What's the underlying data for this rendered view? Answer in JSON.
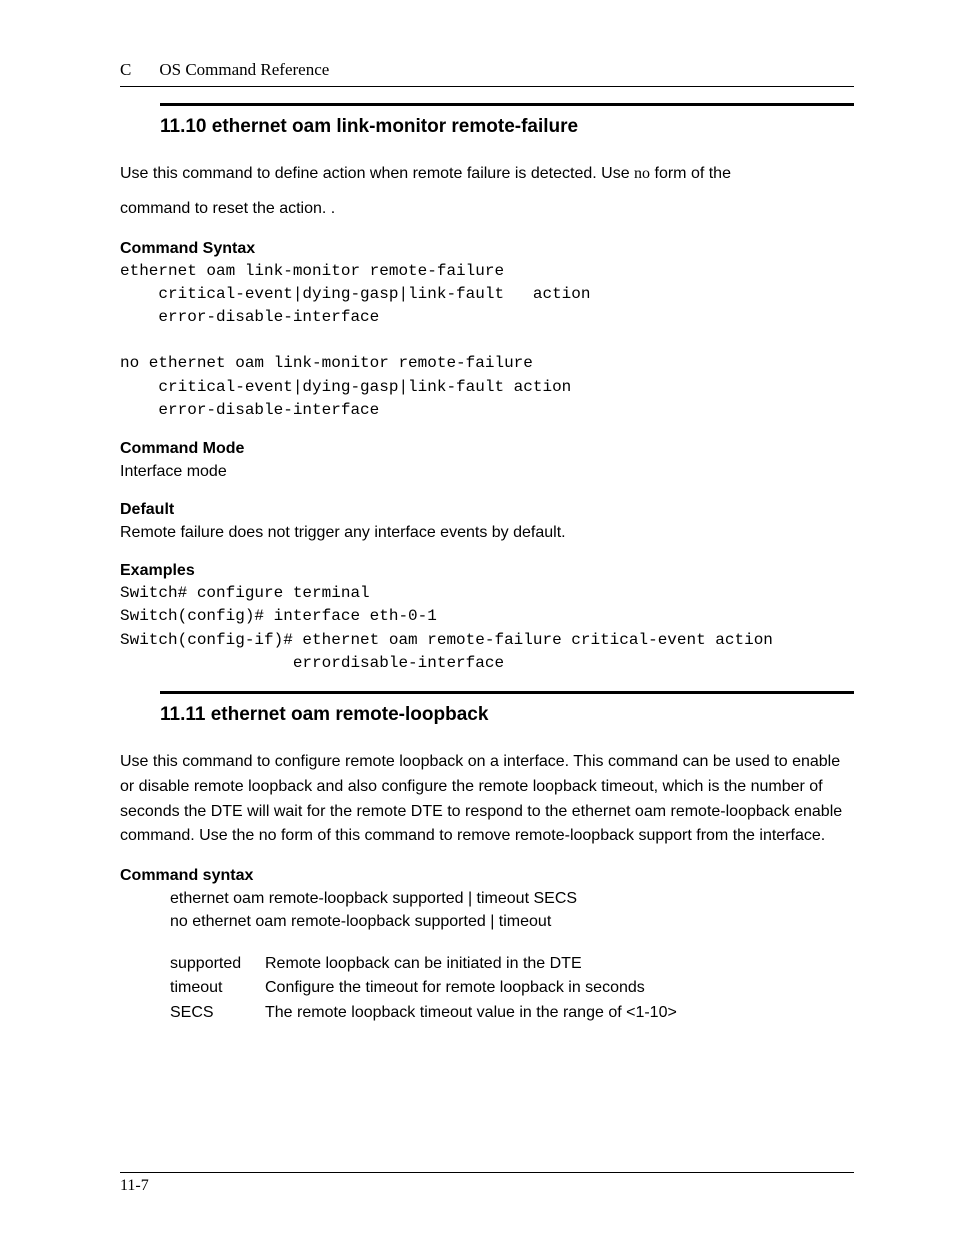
{
  "header": {
    "chapter_letter": "C",
    "doc_title": "OS Command Reference"
  },
  "section1": {
    "number_title": "11.10  ethernet oam link-monitor remote-failure",
    "desc_part1": "Use this command to define action when remote failure is detected. Use ",
    "desc_no": "no",
    "desc_part2": " form of the",
    "desc_line2": "command to reset the action. .",
    "cmd_syntax_label": "Command Syntax",
    "cmd_syntax_code": "ethernet oam link-monitor remote-failure\n    critical-event|dying-gasp|link-fault   action\n    error-disable-interface\n\nno ethernet oam link-monitor remote-failure\n    critical-event|dying-gasp|link-fault action\n    error-disable-interface",
    "cmd_mode_label": "Command Mode",
    "cmd_mode_text": "Interface mode",
    "default_label": "Default",
    "default_text": "Remote failure does not trigger any interface events by default.",
    "examples_label": "Examples",
    "examples_code": "Switch# configure terminal\nSwitch(config)# interface eth-0-1\nSwitch(config-if)# ethernet oam remote-failure critical-event action\n                  errordisable-interface"
  },
  "section2": {
    "number_title": "11.11  ethernet oam remote-loopback",
    "desc": "Use this command to configure remote loopback on a interface. This command can be used to enable or disable remote loopback and also configure the remote loopback timeout, which is the number of seconds the DTE will wait for the remote DTE to respond to the ethernet oam remote-loopback enable command. Use the no form of this command to remove remote-loopback support from the interface.",
    "cmd_syntax_label": "Command syntax",
    "syntax_line1": "ethernet oam remote-loopback supported | timeout SECS",
    "syntax_line2": "no ethernet oam remote-loopback supported | timeout",
    "params": [
      {
        "key": "supported",
        "val": "Remote loopback can be initiated in the DTE"
      },
      {
        "key": "timeout",
        "val": "Configure the timeout for remote loopback in seconds"
      },
      {
        "key": "SECS",
        "val": "The remote loopback timeout value in the range of <1-10>"
      }
    ]
  },
  "footer": {
    "page": "11-7"
  }
}
